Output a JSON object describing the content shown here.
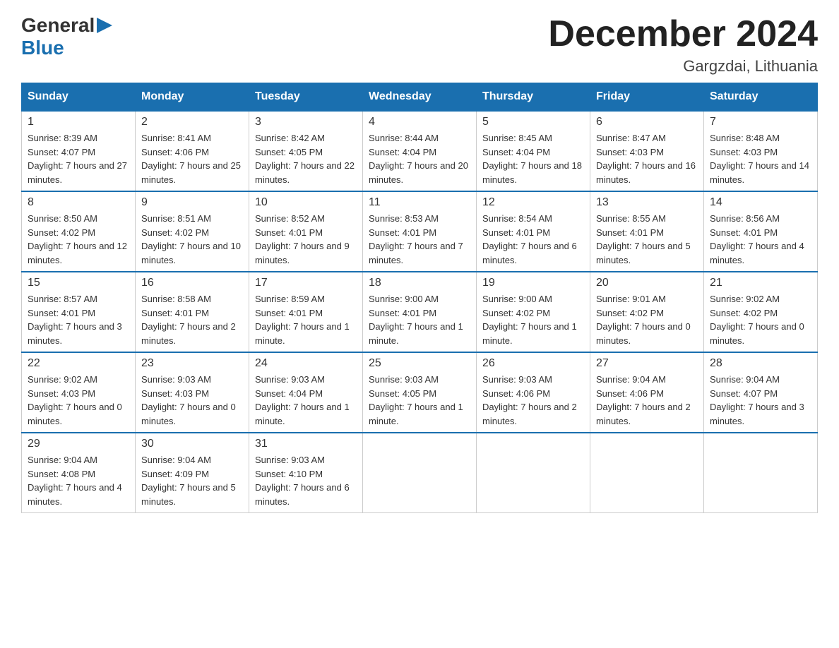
{
  "header": {
    "logo_general": "General",
    "logo_blue": "Blue",
    "month_title": "December 2024",
    "location": "Gargzdai, Lithuania"
  },
  "days_of_week": [
    "Sunday",
    "Monday",
    "Tuesday",
    "Wednesday",
    "Thursday",
    "Friday",
    "Saturday"
  ],
  "weeks": [
    [
      {
        "day": "1",
        "sunrise": "Sunrise: 8:39 AM",
        "sunset": "Sunset: 4:07 PM",
        "daylight": "Daylight: 7 hours and 27 minutes."
      },
      {
        "day": "2",
        "sunrise": "Sunrise: 8:41 AM",
        "sunset": "Sunset: 4:06 PM",
        "daylight": "Daylight: 7 hours and 25 minutes."
      },
      {
        "day": "3",
        "sunrise": "Sunrise: 8:42 AM",
        "sunset": "Sunset: 4:05 PM",
        "daylight": "Daylight: 7 hours and 22 minutes."
      },
      {
        "day": "4",
        "sunrise": "Sunrise: 8:44 AM",
        "sunset": "Sunset: 4:04 PM",
        "daylight": "Daylight: 7 hours and 20 minutes."
      },
      {
        "day": "5",
        "sunrise": "Sunrise: 8:45 AM",
        "sunset": "Sunset: 4:04 PM",
        "daylight": "Daylight: 7 hours and 18 minutes."
      },
      {
        "day": "6",
        "sunrise": "Sunrise: 8:47 AM",
        "sunset": "Sunset: 4:03 PM",
        "daylight": "Daylight: 7 hours and 16 minutes."
      },
      {
        "day": "7",
        "sunrise": "Sunrise: 8:48 AM",
        "sunset": "Sunset: 4:03 PM",
        "daylight": "Daylight: 7 hours and 14 minutes."
      }
    ],
    [
      {
        "day": "8",
        "sunrise": "Sunrise: 8:50 AM",
        "sunset": "Sunset: 4:02 PM",
        "daylight": "Daylight: 7 hours and 12 minutes."
      },
      {
        "day": "9",
        "sunrise": "Sunrise: 8:51 AM",
        "sunset": "Sunset: 4:02 PM",
        "daylight": "Daylight: 7 hours and 10 minutes."
      },
      {
        "day": "10",
        "sunrise": "Sunrise: 8:52 AM",
        "sunset": "Sunset: 4:01 PM",
        "daylight": "Daylight: 7 hours and 9 minutes."
      },
      {
        "day": "11",
        "sunrise": "Sunrise: 8:53 AM",
        "sunset": "Sunset: 4:01 PM",
        "daylight": "Daylight: 7 hours and 7 minutes."
      },
      {
        "day": "12",
        "sunrise": "Sunrise: 8:54 AM",
        "sunset": "Sunset: 4:01 PM",
        "daylight": "Daylight: 7 hours and 6 minutes."
      },
      {
        "day": "13",
        "sunrise": "Sunrise: 8:55 AM",
        "sunset": "Sunset: 4:01 PM",
        "daylight": "Daylight: 7 hours and 5 minutes."
      },
      {
        "day": "14",
        "sunrise": "Sunrise: 8:56 AM",
        "sunset": "Sunset: 4:01 PM",
        "daylight": "Daylight: 7 hours and 4 minutes."
      }
    ],
    [
      {
        "day": "15",
        "sunrise": "Sunrise: 8:57 AM",
        "sunset": "Sunset: 4:01 PM",
        "daylight": "Daylight: 7 hours and 3 minutes."
      },
      {
        "day": "16",
        "sunrise": "Sunrise: 8:58 AM",
        "sunset": "Sunset: 4:01 PM",
        "daylight": "Daylight: 7 hours and 2 minutes."
      },
      {
        "day": "17",
        "sunrise": "Sunrise: 8:59 AM",
        "sunset": "Sunset: 4:01 PM",
        "daylight": "Daylight: 7 hours and 1 minute."
      },
      {
        "day": "18",
        "sunrise": "Sunrise: 9:00 AM",
        "sunset": "Sunset: 4:01 PM",
        "daylight": "Daylight: 7 hours and 1 minute."
      },
      {
        "day": "19",
        "sunrise": "Sunrise: 9:00 AM",
        "sunset": "Sunset: 4:02 PM",
        "daylight": "Daylight: 7 hours and 1 minute."
      },
      {
        "day": "20",
        "sunrise": "Sunrise: 9:01 AM",
        "sunset": "Sunset: 4:02 PM",
        "daylight": "Daylight: 7 hours and 0 minutes."
      },
      {
        "day": "21",
        "sunrise": "Sunrise: 9:02 AM",
        "sunset": "Sunset: 4:02 PM",
        "daylight": "Daylight: 7 hours and 0 minutes."
      }
    ],
    [
      {
        "day": "22",
        "sunrise": "Sunrise: 9:02 AM",
        "sunset": "Sunset: 4:03 PM",
        "daylight": "Daylight: 7 hours and 0 minutes."
      },
      {
        "day": "23",
        "sunrise": "Sunrise: 9:03 AM",
        "sunset": "Sunset: 4:03 PM",
        "daylight": "Daylight: 7 hours and 0 minutes."
      },
      {
        "day": "24",
        "sunrise": "Sunrise: 9:03 AM",
        "sunset": "Sunset: 4:04 PM",
        "daylight": "Daylight: 7 hours and 1 minute."
      },
      {
        "day": "25",
        "sunrise": "Sunrise: 9:03 AM",
        "sunset": "Sunset: 4:05 PM",
        "daylight": "Daylight: 7 hours and 1 minute."
      },
      {
        "day": "26",
        "sunrise": "Sunrise: 9:03 AM",
        "sunset": "Sunset: 4:06 PM",
        "daylight": "Daylight: 7 hours and 2 minutes."
      },
      {
        "day": "27",
        "sunrise": "Sunrise: 9:04 AM",
        "sunset": "Sunset: 4:06 PM",
        "daylight": "Daylight: 7 hours and 2 minutes."
      },
      {
        "day": "28",
        "sunrise": "Sunrise: 9:04 AM",
        "sunset": "Sunset: 4:07 PM",
        "daylight": "Daylight: 7 hours and 3 minutes."
      }
    ],
    [
      {
        "day": "29",
        "sunrise": "Sunrise: 9:04 AM",
        "sunset": "Sunset: 4:08 PM",
        "daylight": "Daylight: 7 hours and 4 minutes."
      },
      {
        "day": "30",
        "sunrise": "Sunrise: 9:04 AM",
        "sunset": "Sunset: 4:09 PM",
        "daylight": "Daylight: 7 hours and 5 minutes."
      },
      {
        "day": "31",
        "sunrise": "Sunrise: 9:03 AM",
        "sunset": "Sunset: 4:10 PM",
        "daylight": "Daylight: 7 hours and 6 minutes."
      },
      null,
      null,
      null,
      null
    ]
  ]
}
